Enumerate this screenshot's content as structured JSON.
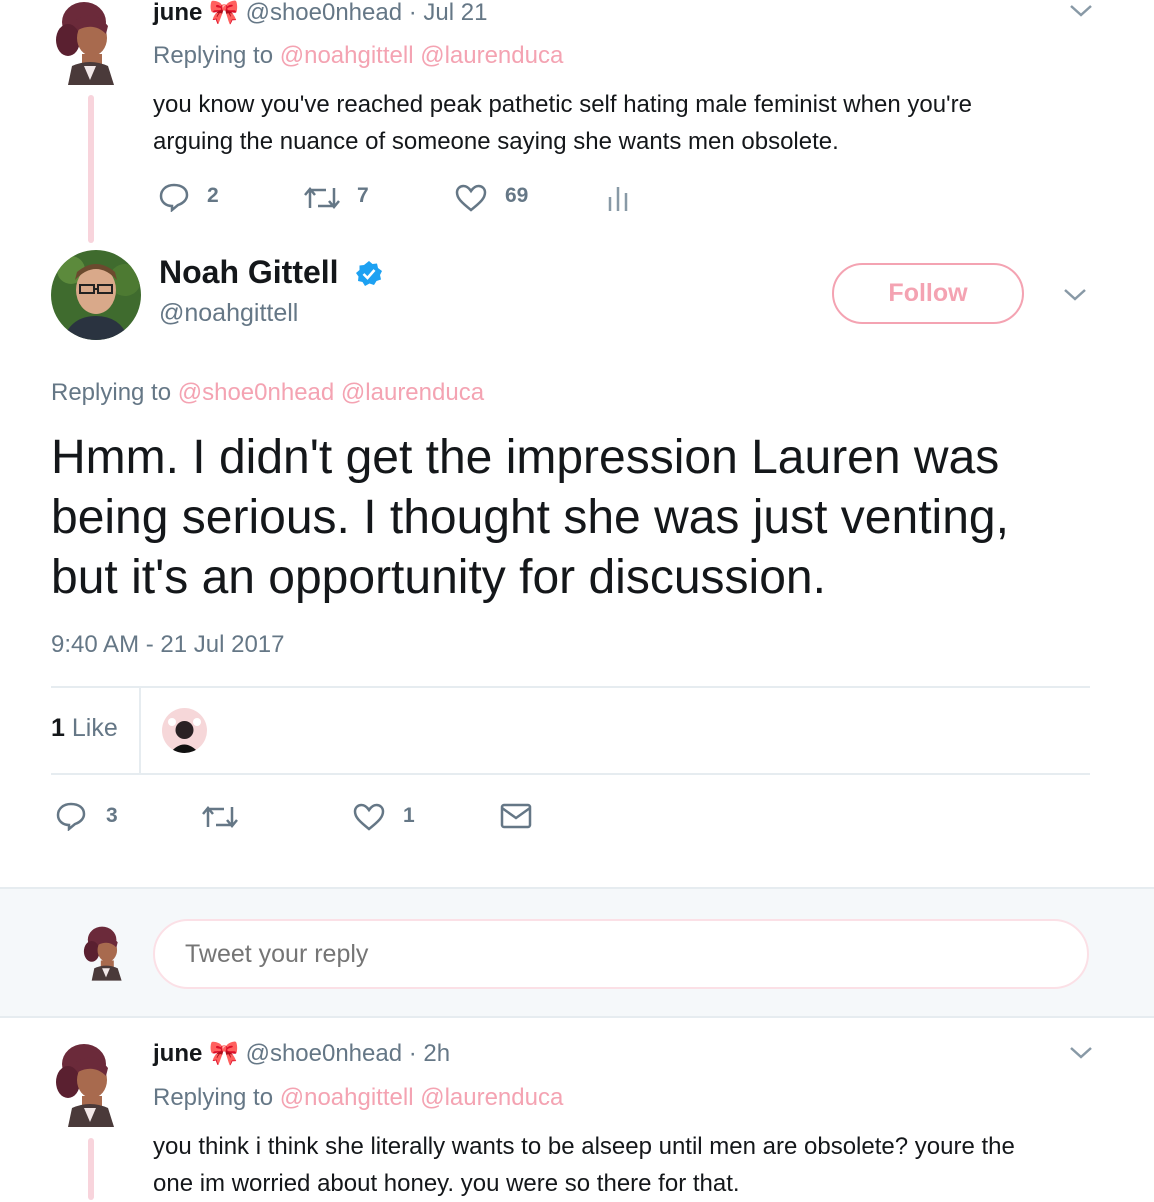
{
  "tweet1": {
    "name": "june",
    "bow_emoji": "🎀",
    "handle": "@shoe0nhead",
    "time": "· Jul 21",
    "replying_label": "Replying to",
    "replying_to": [
      "@noahgittell",
      "@laurenduca"
    ],
    "text_line1": "you know you've reached peak pathetic self hating male feminist when you're",
    "text_line2": "arguing the nuance of someone saying she wants men obsolete.",
    "replies": "2",
    "retweets": "7",
    "likes": "69"
  },
  "main": {
    "name": "Noah Gittell",
    "handle": "@noahgittell",
    "follow_label": "Follow",
    "replying_label": "Replying to",
    "replying_to": [
      "@shoe0nhead",
      "@laurenduca"
    ],
    "text_line1": "Hmm. I didn't get the impression Lauren was",
    "text_line2": "being serious. I thought she was just venting,",
    "text_line3": "but it's an opportunity for discussion.",
    "timestamp": "9:40 AM - 21 Jul 2017",
    "like_count": "1",
    "like_label": "Like",
    "replies": "3",
    "likes": "1"
  },
  "reply_box": {
    "placeholder": "Tweet your reply"
  },
  "tweet2": {
    "name": "june",
    "bow_emoji": "🎀",
    "handle": "@shoe0nhead",
    "time": "· 2h",
    "replying_label": "Replying to",
    "replying_to": [
      "@noahgittell",
      "@laurenduca"
    ],
    "text_line1": "you think i think she literally wants to be alseep until men are obsolete? youre the",
    "text_line2": "one im worried about honey. you were so there for that."
  },
  "colors": {
    "accent_pink": "#f4a3b2",
    "gray": "#657786",
    "verified_blue": "#1da1f2",
    "thread_line": "#f8d4dc"
  },
  "icons": [
    "reply-icon",
    "retweet-icon",
    "like-icon",
    "analytics-icon",
    "mail-icon",
    "chevron-down-icon",
    "verified-badge-icon",
    "bow-icon"
  ]
}
